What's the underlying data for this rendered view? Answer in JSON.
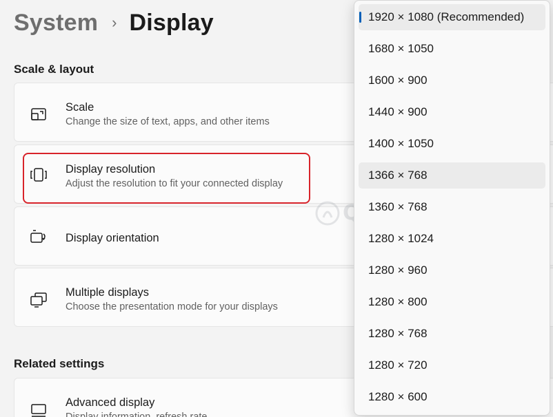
{
  "breadcrumb": {
    "parent": "System",
    "separator": "›",
    "current": "Display"
  },
  "sections": {
    "scale_layout": "Scale & layout",
    "related": "Related settings"
  },
  "cards": {
    "scale": {
      "title": "Scale",
      "desc": "Change the size of text, apps, and other items",
      "icon": "scale-icon"
    },
    "resolution": {
      "title": "Display resolution",
      "desc": "Adjust the resolution to fit your connected display",
      "icon": "resolution-icon"
    },
    "orientation": {
      "title": "Display orientation",
      "icon": "orientation-icon"
    },
    "multiple": {
      "title": "Multiple displays",
      "desc": "Choose the presentation mode for your displays",
      "icon": "multiple-displays-icon"
    },
    "advanced": {
      "title": "Advanced display",
      "desc": "Display information, refresh rate",
      "icon": "monitor-icon"
    }
  },
  "resolution_options": [
    "1920 × 1080 (Recommended)",
    "1680 × 1050",
    "1600 × 900",
    "1440 × 900",
    "1400 × 1050",
    "1366 × 768",
    "1360 × 768",
    "1280 × 1024",
    "1280 × 960",
    "1280 × 800",
    "1280 × 768",
    "1280 × 720",
    "1280 × 600"
  ],
  "selected_resolution": "1920 × 1080 (Recommended)",
  "hovered_resolution": "1366 × 768",
  "watermark": "Quantrimang",
  "colors": {
    "accent": "#005fb8",
    "highlight_border": "#d8232a"
  }
}
